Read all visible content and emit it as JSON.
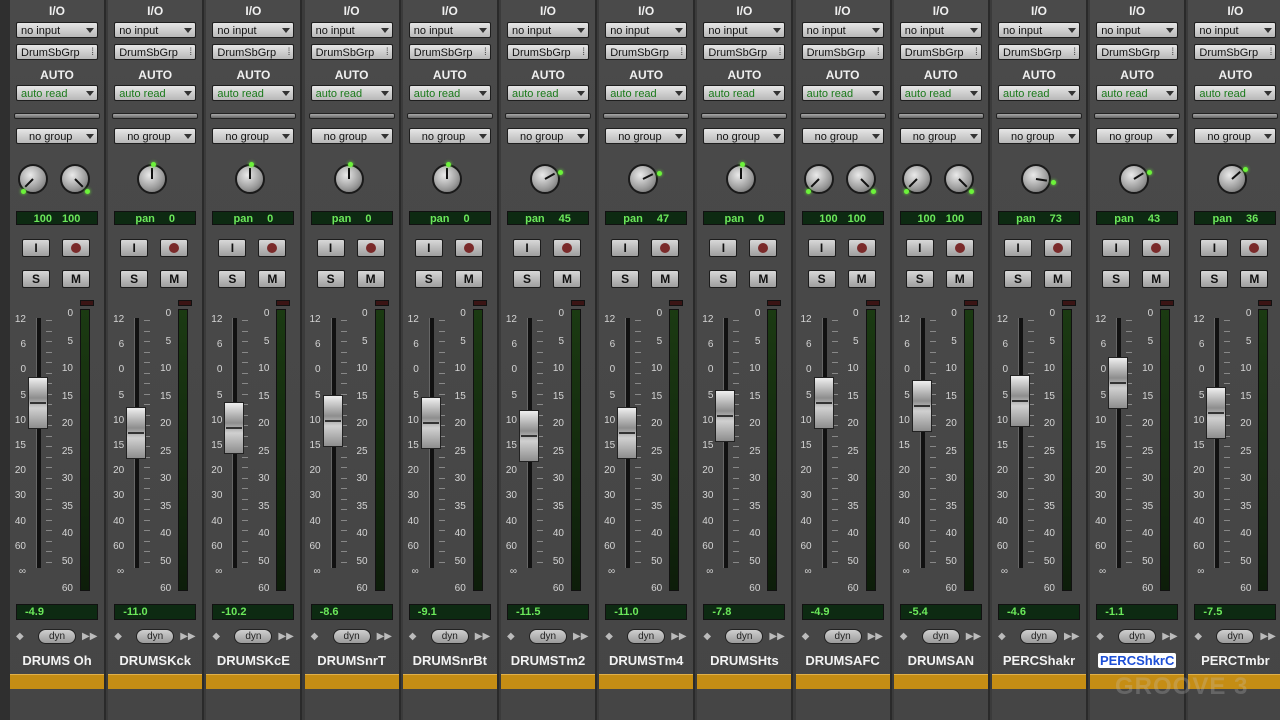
{
  "labels": {
    "io": "I/O",
    "auto": "AUTO",
    "input": "no input",
    "output": "DrumSbGrp",
    "automation": "auto read",
    "group": "no group",
    "input_btn": "I",
    "solo": "S",
    "mute": "M",
    "dyn": "dyn"
  },
  "fader_scale": [
    "12",
    "6",
    "0",
    "5",
    "10",
    "15",
    "20",
    "30",
    "40",
    "60",
    "∞"
  ],
  "meter_scale": [
    "0",
    "5",
    "10",
    "15",
    "20",
    "25",
    "30",
    "35",
    "40",
    "50",
    "60"
  ],
  "watermark": "GROOVE 3",
  "colors": {
    "track_color": "#c58d14",
    "meter_green": "#6be85a",
    "selected_name": "#1d4fd6"
  },
  "strips": [
    {
      "name": "DRUMS Oh",
      "stereo": true,
      "pan_l": "100",
      "pan_r": "100",
      "vol": "-4.9",
      "fader": 0.34,
      "selected": false
    },
    {
      "name": "DRUMSKck",
      "stereo": false,
      "pan_label": "pan",
      "pan_val": "0",
      "vol": "-11.0",
      "fader": 0.46,
      "selected": false
    },
    {
      "name": "DRUMSKcE",
      "stereo": false,
      "pan_label": "pan",
      "pan_val": "0",
      "vol": "-10.2",
      "fader": 0.44,
      "selected": false
    },
    {
      "name": "DRUMSnrT",
      "stereo": false,
      "pan_label": "pan",
      "pan_val": "0",
      "vol": "-8.6",
      "fader": 0.41,
      "selected": false
    },
    {
      "name": "DRUMSnrBt",
      "stereo": false,
      "pan_label": "pan",
      "pan_val": "0",
      "vol": "-9.1",
      "fader": 0.42,
      "selected": false
    },
    {
      "name": "DRUMSTm2",
      "stereo": false,
      "pan_label": "pan",
      "pan_val": "45",
      "vol": "-11.5",
      "fader": 0.47,
      "selected": false
    },
    {
      "name": "DRUMSTm4",
      "stereo": false,
      "pan_label": "pan",
      "pan_val": "47",
      "vol": "-11.0",
      "fader": 0.46,
      "selected": false
    },
    {
      "name": "DRUMSHts",
      "stereo": false,
      "pan_label": "pan",
      "pan_val": "0",
      "vol": "-7.8",
      "fader": 0.39,
      "selected": false
    },
    {
      "name": "DRUMSAFC",
      "stereo": true,
      "pan_l": "100",
      "pan_r": "100",
      "vol": "-4.9",
      "fader": 0.34,
      "selected": false
    },
    {
      "name": "DRUMSAN",
      "stereo": true,
      "pan_l": "100",
      "pan_r": "100",
      "vol": "-5.4",
      "fader": 0.35,
      "selected": false
    },
    {
      "name": "PERCShakr",
      "stereo": false,
      "pan_label": "pan",
      "pan_val": "73",
      "vol": "-4.6",
      "fader": 0.33,
      "selected": false
    },
    {
      "name": "PERCShkrC",
      "stereo": false,
      "pan_label": "pan",
      "pan_val": "43",
      "vol": "-1.1",
      "fader": 0.26,
      "selected": true
    },
    {
      "name": "PERCTmbr",
      "stereo": false,
      "pan_label": "pan",
      "pan_val": "36",
      "vol": "-7.5",
      "fader": 0.38,
      "selected": false
    }
  ]
}
